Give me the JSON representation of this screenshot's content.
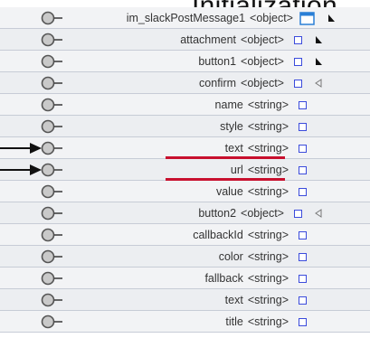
{
  "header": {
    "title": "Initialization"
  },
  "tree": {
    "rows": [
      {
        "name": "im_slackPostMessage1",
        "type": "<object>",
        "controls": [
          "window",
          "triangle"
        ],
        "marked": false
      },
      {
        "name": "attachment",
        "type": "<object>",
        "controls": [
          "checkbox",
          "triangle"
        ],
        "marked": false
      },
      {
        "name": "button1",
        "type": "<object>",
        "controls": [
          "checkbox",
          "triangle"
        ],
        "marked": false
      },
      {
        "name": "confirm",
        "type": "<object>",
        "controls": [
          "checkbox",
          "triangle-outline"
        ],
        "marked": false
      },
      {
        "name": "name",
        "type": "<string>",
        "controls": [
          "checkbox"
        ],
        "marked": false
      },
      {
        "name": "style",
        "type": "<string>",
        "controls": [
          "checkbox"
        ],
        "marked": false
      },
      {
        "name": "text",
        "type": "<string>",
        "controls": [
          "checkbox"
        ],
        "marked": true
      },
      {
        "name": "url",
        "type": "<string>",
        "controls": [
          "checkbox"
        ],
        "marked": true
      },
      {
        "name": "value",
        "type": "<string>",
        "controls": [
          "checkbox"
        ],
        "marked": false
      },
      {
        "name": "button2",
        "type": "<object>",
        "controls": [
          "checkbox",
          "triangle-outline"
        ],
        "marked": false
      },
      {
        "name": "callbackId",
        "type": "<string>",
        "controls": [
          "checkbox"
        ],
        "marked": false
      },
      {
        "name": "color",
        "type": "<string>",
        "controls": [
          "checkbox"
        ],
        "marked": false
      },
      {
        "name": "fallback",
        "type": "<string>",
        "controls": [
          "checkbox"
        ],
        "marked": false
      },
      {
        "name": "text",
        "type": "<string>",
        "controls": [
          "checkbox"
        ],
        "marked": false
      },
      {
        "name": "title",
        "type": "<string>",
        "controls": [
          "checkbox"
        ],
        "marked": false
      }
    ]
  },
  "colors": {
    "checkbox": "#3b4bdc",
    "underline": "#c8102e",
    "row_bg": "#f2f3f5",
    "row_border": "#c7ccd6"
  },
  "icons": {
    "connector": "circle-connector-icon",
    "arrow": "arrow-right-icon",
    "checkbox": "checkbox-icon",
    "window": "window-icon",
    "triangle": "triangle-solid-icon",
    "triangle_outline": "triangle-outline-icon"
  }
}
